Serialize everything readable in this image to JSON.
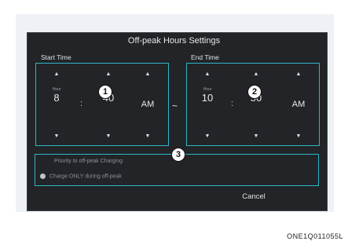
{
  "dialog": {
    "title": "Off-peak Hours Settings",
    "cancel_label": "Cancel"
  },
  "start_time": {
    "label": "Start Time",
    "hour_unit": "Hour",
    "hour": "8",
    "min_unit": "Min",
    "minute": "40",
    "ampm": "AM"
  },
  "end_time": {
    "label": "End Time",
    "hour_unit": "Hour",
    "hour": "10",
    "min_unit": "Min",
    "minute": "50",
    "ampm": "AM"
  },
  "separator": "~",
  "colon": ":",
  "arrows": {
    "up": "▲",
    "down": "▼"
  },
  "options": {
    "priority": "Priority to off-peak Charging",
    "charge_only": "Charge ONLY during off-peak"
  },
  "callouts": [
    "1",
    "2",
    "3"
  ],
  "caption": "ONE1Q011055L",
  "colors": {
    "accent": "#2fb6c6",
    "screen_bg": "#222427"
  }
}
